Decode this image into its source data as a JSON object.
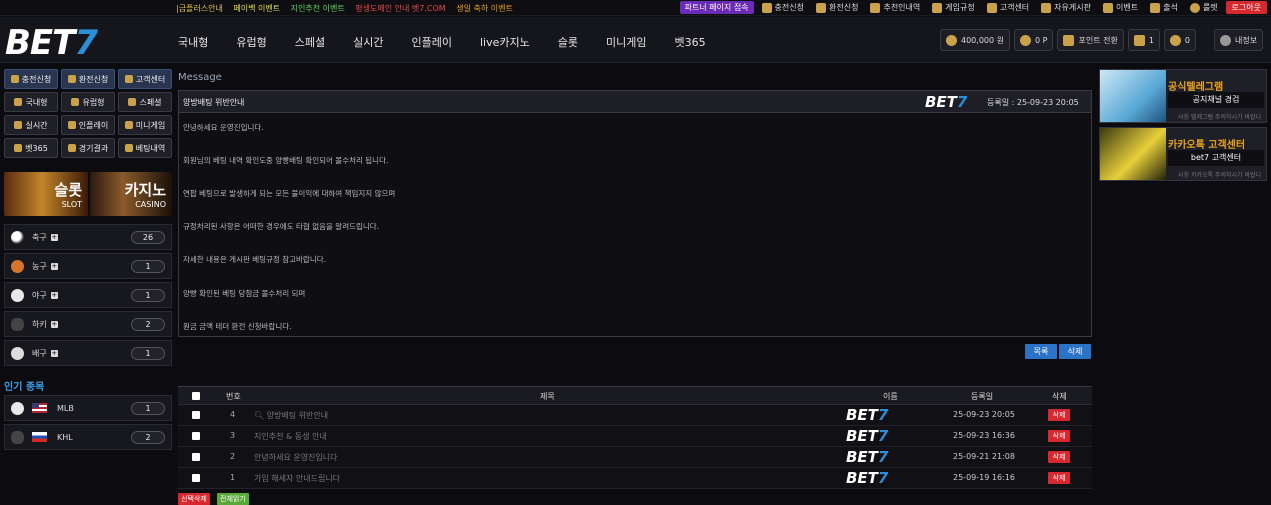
{
  "ticker": [
    {
      "text": "|금플러스안내",
      "color": "#e0c050"
    },
    {
      "text": "페이백 이벤트",
      "color": "#e0e050"
    },
    {
      "text": "지인추천 이벤트",
      "color": "#5fd85f"
    },
    {
      "text": "평생도메인 안내 벳7.COM",
      "color": "#e84a4a"
    },
    {
      "text": "생일 축하 이벤트",
      "color": "#e8a21f"
    }
  ],
  "toplinks": {
    "partner": "파트너 페이지 접속",
    "items": [
      "충전신청",
      "환전신청",
      "추천인내역",
      "게임규정",
      "고객센터",
      "자유게시판",
      "이벤트",
      "출석",
      "룰렛"
    ],
    "logout": "로그아웃"
  },
  "logo": {
    "main": "BET",
    "seven": "7"
  },
  "nav": [
    "국내형",
    "유럽형",
    "스페셜",
    "실시간",
    "인플레이",
    "live카지노",
    "슬롯",
    "미니게임",
    "벳365"
  ],
  "user": {
    "money": "400,000 원",
    "point": "0 P",
    "point_convert": "포인트 전환",
    "badge1": "1",
    "badge2": "0",
    "myinfo": "내정보"
  },
  "quick": [
    [
      "충전신청",
      "환전신청",
      "고객센터"
    ],
    [
      "국내형",
      "유럽형",
      "스페셜"
    ],
    [
      "실시간",
      "인플레이",
      "미니게임"
    ],
    [
      "벳365",
      "경기결과",
      "베팅내역"
    ]
  ],
  "banners": {
    "slot": {
      "title": "슬롯",
      "sub": "SLOT"
    },
    "casino": {
      "title": "카지노",
      "sub": "CASINO"
    }
  },
  "sports": [
    {
      "name": "축구",
      "count": "26",
      "color": "#f2f2f2"
    },
    {
      "name": "농구",
      "count": "1",
      "color": "#e07a2a"
    },
    {
      "name": "야구",
      "count": "1",
      "color": "#e8e8e8"
    },
    {
      "name": "하키",
      "count": "2",
      "color": "#333333"
    },
    {
      "name": "배구",
      "count": "1",
      "color": "#e0e0e0"
    }
  ],
  "popular": {
    "title": "인기 종목",
    "items": [
      {
        "name": "MLB",
        "count": "1"
      },
      {
        "name": "KHL",
        "count": "2"
      }
    ]
  },
  "message": {
    "section_title": "Message",
    "subject": "양방배팅 위반안내",
    "date_label": "등록일 : 25-09-23 20:05",
    "lines": [
      "안녕하세요 운영진입니다.",
      "회원님의 베팅 내역 확인도중 양빵배팅 확인되어 몰수처리 됩니다.",
      "연팝 베팅으로 발생하게 되는 모든 불이익에 대하여 책임지지 않으며",
      "규정처리된 사항은 어떠한 경우에도 타협 없음을 알려드립니다.",
      "자세한 내용은 게시판 베팅규정 참고바랍니다.",
      "양빵 확인된 베팅 당첨금 몰수처리 되며",
      "원금 금액 테더 환전 신청바랍니다."
    ],
    "btn_list": "목록",
    "btn_delete": "삭제"
  },
  "table": {
    "headers": {
      "no": "번호",
      "subject": "제목",
      "name": "이름",
      "date": "등록일",
      "delete": "삭제"
    },
    "rows": [
      {
        "no": "4",
        "subject": "양방배팅 위반안내",
        "date": "25-09-23 20:05",
        "del": "삭제"
      },
      {
        "no": "3",
        "subject": "지인추천 & 동생 안내",
        "date": "25-09-23 16:36",
        "del": "삭제"
      },
      {
        "no": "2",
        "subject": "안녕하세요 운영진입니다",
        "date": "25-09-21 21:08",
        "del": "삭제"
      },
      {
        "no": "1",
        "subject": "가입 해세자 안내드립니다",
        "date": "25-09-19 16:16",
        "del": "삭제"
      }
    ],
    "btn_select_delete": "선택삭제",
    "btn_read_all": "전체읽기"
  },
  "right": [
    {
      "title": "공식텔레그램",
      "box": "공지채널 경검",
      "small": "사칭 텔레그램 주의하시기 바랍니다"
    },
    {
      "title": "카카오톡 고객센터",
      "box": "bet7 고객센터",
      "small": "사칭 카카오톡 주의하시기 바랍니다"
    }
  ]
}
